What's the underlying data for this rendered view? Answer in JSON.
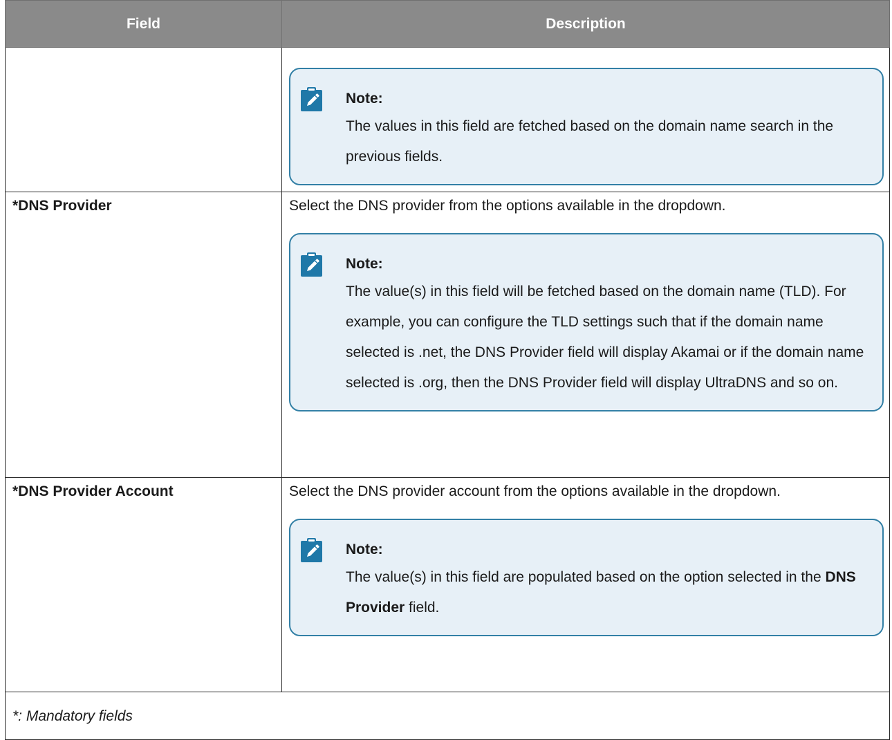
{
  "table": {
    "headers": {
      "field": "Field",
      "description": "Description"
    },
    "rows": [
      {
        "field": "",
        "description": "",
        "note": {
          "title": "Note:",
          "text": "The values in this field are fetched based on the domain name search in the previous fields."
        }
      },
      {
        "field": "*DNS Provider",
        "description": "Select the DNS provider from the options available in the dropdown.",
        "note": {
          "title": "Note:",
          "text": "The value(s) in this field will be fetched based on the domain name (TLD). For example, you can configure the TLD settings such that if the domain name selected is .net, the DNS Provider field will display Akamai or if the domain name selected is .org, then the DNS Provider field will display UltraDNS and so on."
        }
      },
      {
        "field": "*DNS Provider Account",
        "description": "Select the DNS provider account from the options available in the dropdown.",
        "note": {
          "title": "Note:",
          "text_before": "The value(s) in this field are populated based on the option selected in the ",
          "text_bold": "DNS Provider",
          "text_after": " field."
        }
      }
    ],
    "footnote": "*: Mandatory fields"
  },
  "icons": {
    "note_icon": "pencil-edit-icon"
  },
  "colors": {
    "header_bg": "#8a8a8a",
    "note_bg": "#e7f0f7",
    "note_border": "#3380a6",
    "icon_bg": "#1f78a8"
  }
}
